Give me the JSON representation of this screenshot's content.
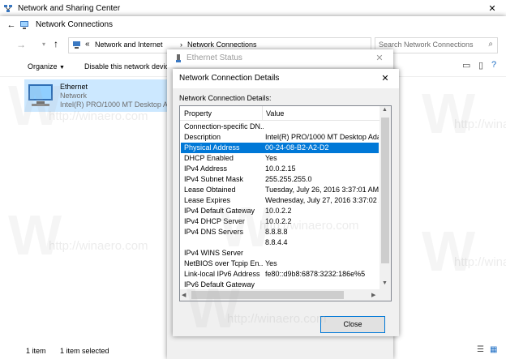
{
  "back_window": {
    "title": "Network and Sharing Center"
  },
  "explorer": {
    "title": "Network Connections",
    "breadcrumb": {
      "chevron": "«",
      "part1": "Network and Internet",
      "sep": "›",
      "part2": "Network Connections"
    },
    "search_placeholder": "Search Network Connections",
    "toolbar": {
      "organize": "Organize",
      "disable": "Disable this network device"
    },
    "item": {
      "name": "Ethernet",
      "network": "Network",
      "adapter": "Intel(R) PRO/1000 MT Desktop Ad"
    },
    "status": {
      "count": "1 item",
      "selected": "1 item selected"
    }
  },
  "ethernet_status": {
    "title": "Ethernet Status"
  },
  "details_dialog": {
    "title": "Network Connection Details",
    "label": "Network Connection Details:",
    "columns": [
      "Property",
      "Value"
    ],
    "rows": [
      {
        "property": "Connection-specific DN...",
        "value": ""
      },
      {
        "property": "Description",
        "value": "Intel(R) PRO/1000 MT Desktop Adap"
      },
      {
        "property": "Physical Address",
        "value": "00-24-08-B2-A2-D2"
      },
      {
        "property": "DHCP Enabled",
        "value": "Yes"
      },
      {
        "property": "IPv4 Address",
        "value": "10.0.2.15"
      },
      {
        "property": "IPv4 Subnet Mask",
        "value": "255.255.255.0"
      },
      {
        "property": "Lease Obtained",
        "value": "Tuesday, July 26, 2016 3:37:01 AM"
      },
      {
        "property": "Lease Expires",
        "value": "Wednesday, July 27, 2016 3:37:02 AM"
      },
      {
        "property": "IPv4 Default Gateway",
        "value": "10.0.2.2"
      },
      {
        "property": "IPv4 DHCP Server",
        "value": "10.0.2.2"
      },
      {
        "property": "IPv4 DNS Servers",
        "value": "8.8.8.8"
      },
      {
        "property": "",
        "value": "8.8.4.4"
      },
      {
        "property": "IPv4 WINS Server",
        "value": ""
      },
      {
        "property": "NetBIOS over Tcpip En...",
        "value": "Yes"
      },
      {
        "property": "Link-local IPv6 Address",
        "value": "fe80::d9b8:6878:3232:186e%5"
      },
      {
        "property": "IPv6 Default Gateway",
        "value": ""
      }
    ],
    "selected_row": 2,
    "close_label": "Close"
  },
  "watermark": {
    "text": "http://winaero.com",
    "letter": "W"
  }
}
